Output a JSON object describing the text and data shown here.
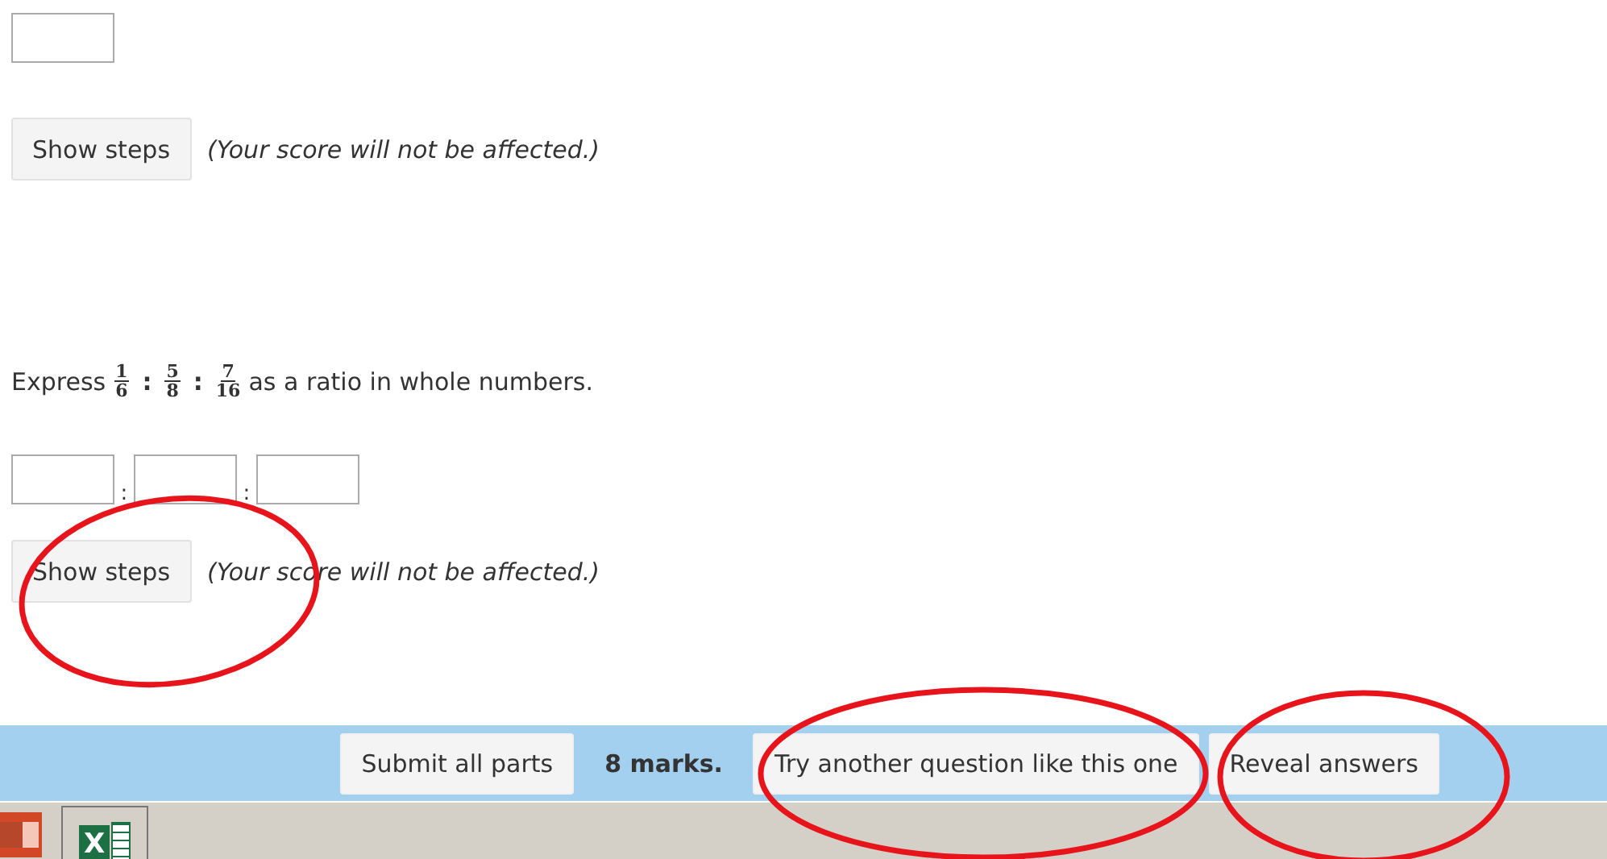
{
  "part_1": {
    "answer": {
      "kind": "box"
    },
    "show_steps": "Show steps",
    "note": "(Your score will not be affected.)"
  },
  "part_2": {
    "prompt": {
      "before": "Express",
      "fractions": [
        {
          "numerator": "1",
          "denominator": "6"
        },
        {
          "numerator": "5",
          "denominator": "8"
        },
        {
          "numerator": "7",
          "denominator": "16"
        }
      ],
      "separator": ":",
      "after": "as a ratio in whole numbers."
    },
    "answer_separator": ":",
    "answers": [
      {
        "kind": "box"
      },
      {
        "kind": "box"
      },
      {
        "kind": "box"
      }
    ],
    "show_steps": "Show steps",
    "note": "(Your score will not be affected.)"
  },
  "footer": {
    "submit": "Submit all parts",
    "marks": "8 marks.",
    "try_another": "Try another question like this one",
    "reveal": "Reveal answers"
  },
  "taskbar": {
    "apps": [
      {
        "kind": "slides"
      },
      {
        "kind": "sheet",
        "letter": "X"
      }
    ]
  },
  "annotations": [
    {
      "kind": "ellipse"
    },
    {
      "kind": "ellipse"
    },
    {
      "kind": "ellipse"
    }
  ]
}
